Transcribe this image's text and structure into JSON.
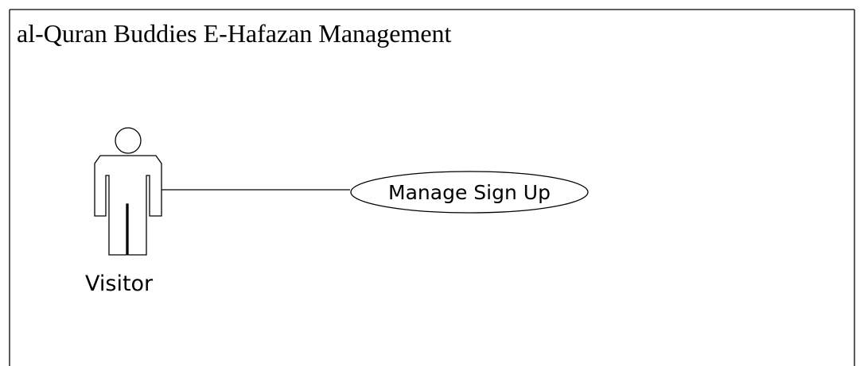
{
  "system": {
    "title": "al-Quran Buddies E-Hafazan Management"
  },
  "actor": {
    "name": "Visitor"
  },
  "use_case": {
    "label": "Manage Sign Up"
  }
}
